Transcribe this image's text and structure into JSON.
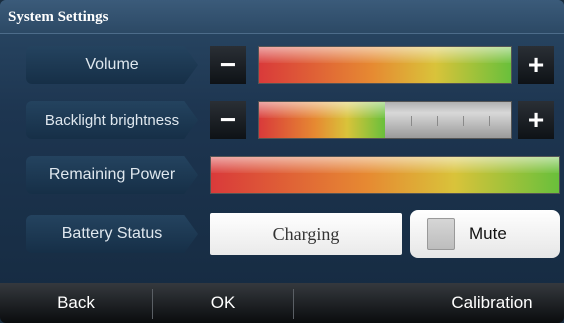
{
  "window": {
    "title": "System Settings"
  },
  "volume": {
    "label": "Volume",
    "minus": "−",
    "plus": "+",
    "level": 1.0
  },
  "backlight": {
    "label": "Backlight brightness",
    "minus": "−",
    "plus": "+",
    "level": 0.5
  },
  "power": {
    "label": "Remaining Power",
    "level": 1.0
  },
  "battery": {
    "label": "Battery Status",
    "value": "Charging"
  },
  "mute": {
    "label": "Mute",
    "checked": false
  },
  "bottom": {
    "back": "Back",
    "ok": "OK",
    "calibration": "Calibration"
  },
  "colors": {
    "accent_red": "#d93a3a",
    "accent_green": "#69c03b",
    "bar_bg": "#1d3550"
  }
}
